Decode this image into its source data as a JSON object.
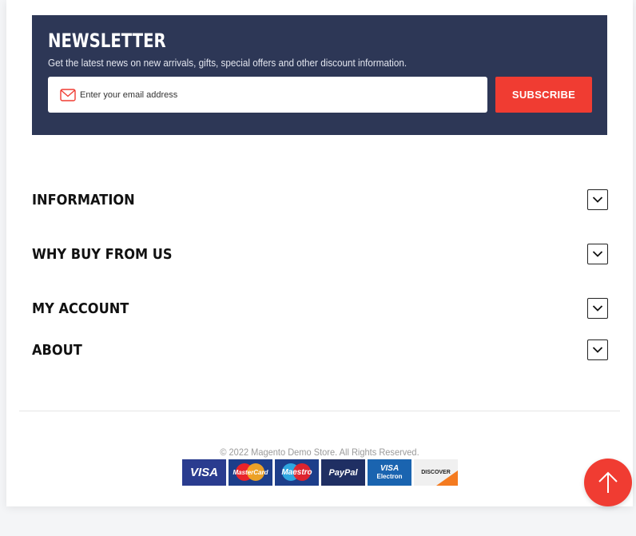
{
  "newsletter": {
    "title": "NEWSLETTER",
    "description": "Get the latest news on new arrivals, gifts, special offers and other discount information.",
    "email_placeholder": "Enter your email address",
    "subscribe_label": "SUBSCRIBE",
    "icon": "mail-icon"
  },
  "footer_sections": [
    {
      "title": "INFORMATION",
      "icon": "chevron-down-icon"
    },
    {
      "title": "WHY BUY FROM US",
      "icon": "chevron-down-icon"
    },
    {
      "title": "MY ACCOUNT",
      "icon": "chevron-down-icon"
    },
    {
      "title": "ABOUT",
      "icon": "chevron-down-icon"
    }
  ],
  "copyright": "© 2022 Magento Demo Store. All Rights Reserved.",
  "payment_methods": [
    {
      "name": "VISA",
      "label": "VISA"
    },
    {
      "name": "MasterCard",
      "label": "MasterCard"
    },
    {
      "name": "Maestro",
      "label": "Maestro"
    },
    {
      "name": "PayPal",
      "label": "PayPal"
    },
    {
      "name": "Visa Electron",
      "label": "VISA",
      "sub_label": "Electron"
    },
    {
      "name": "Discover",
      "label": "DISCOVER"
    }
  ],
  "back_to_top": {
    "icon": "arrow-up-icon"
  },
  "colors": {
    "newsletter_bg": "#2d3756",
    "accent": "#f03c32",
    "page_bg": "#ffffff"
  }
}
